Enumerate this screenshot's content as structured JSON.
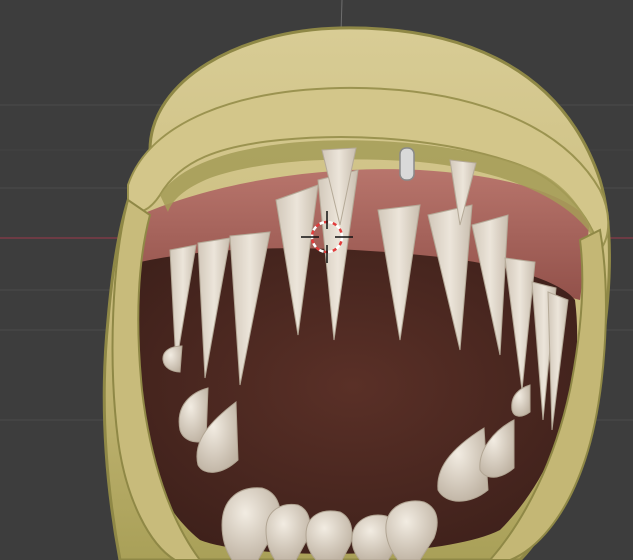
{
  "viewport": {
    "background": "#3d3d3d",
    "grid_color": "#4a4a4a",
    "x_axis_color": "#8a3b48",
    "y_axis_color": "#6f8a3a"
  },
  "model": {
    "shell_color": "#cdbf82",
    "shell_shadow_color": "#8f8846",
    "gum_color": "#a8615a",
    "mouth_color": "#4e2a22",
    "tooth_color": "#e2d9cc"
  },
  "cursor_3d": {
    "ring_colors": [
      "#ffffff",
      "#e23b3b"
    ]
  }
}
